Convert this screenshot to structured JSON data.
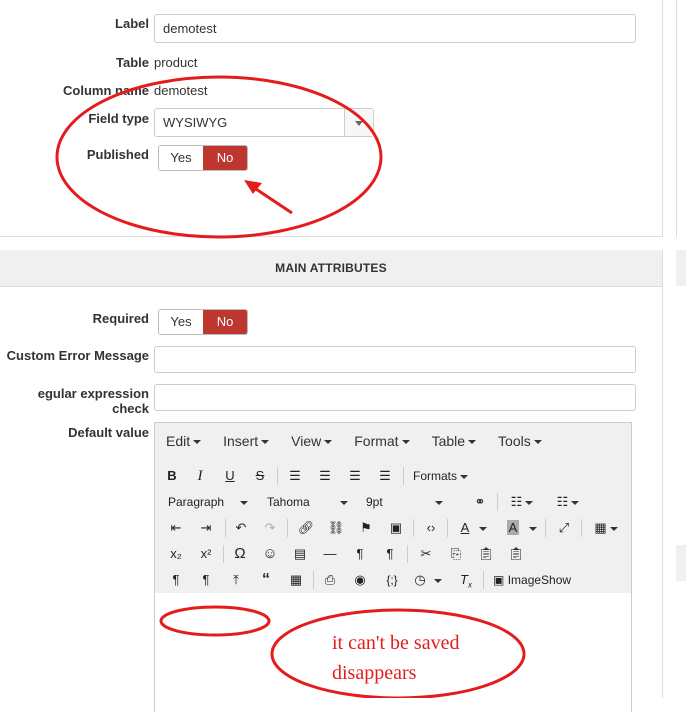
{
  "form": {
    "label_label": "Label",
    "label_value": "demotest",
    "table_label": "Table",
    "table_value": "product",
    "column_label": "Column name",
    "column_value": "demotest",
    "fieldtype_label": "Field type",
    "fieldtype_value": "WYSIWYG",
    "published_label": "Published",
    "published_yes": "Yes",
    "published_no": "No"
  },
  "main": {
    "title": "MAIN ATTRIBUTES",
    "required_label": "Required",
    "required_yes": "Yes",
    "required_no": "No",
    "error_label": "Custom Error Message",
    "regex_label": "egular expression check",
    "default_label": "Default value"
  },
  "editor": {
    "menus": [
      "Edit",
      "Insert",
      "View",
      "Format",
      "Table",
      "Tools"
    ],
    "formats_label": "Formats",
    "block_value": "Paragraph",
    "font_value": "Tahoma",
    "size_value": "9pt",
    "imageshow_label": "ImageShow"
  },
  "annotations": {
    "note_line1": "it can't be saved",
    "note_line2": "disappears"
  },
  "colors": {
    "accent_red": "#bd362f",
    "annotation_red": "#e41c1c"
  }
}
